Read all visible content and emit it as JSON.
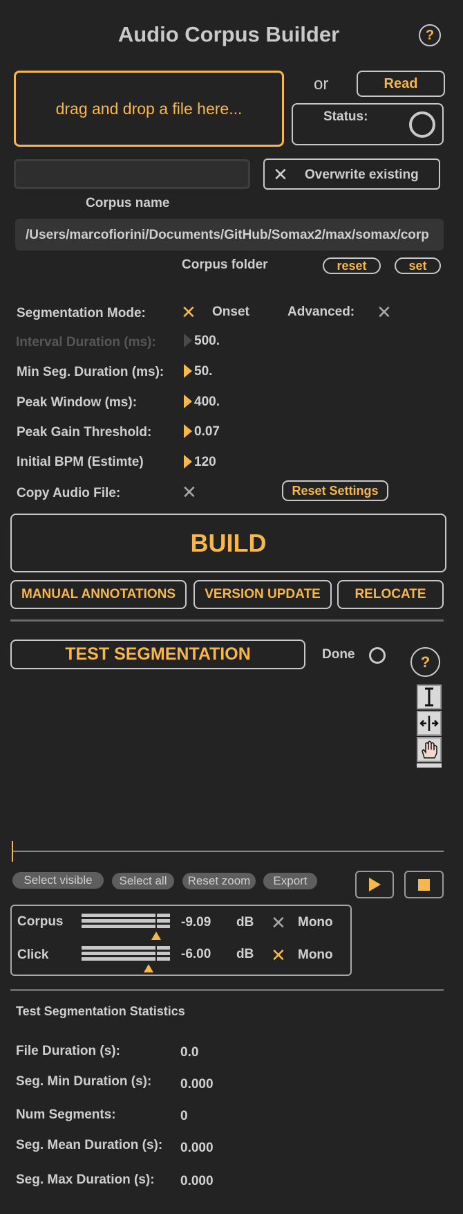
{
  "header": {
    "title": "Audio Corpus Builder",
    "help_label": "?"
  },
  "drop_zone": {
    "label": "drag and drop a file here..."
  },
  "or_label": "or",
  "read_button": "Read",
  "status": {
    "label": "Status:"
  },
  "overwrite": {
    "label": "Overwrite existing"
  },
  "corpus_name": {
    "label": "Corpus name",
    "value": ""
  },
  "corpus_folder": {
    "path": "/Users/marcofiorini/Documents/GitHub/Somax2/max/somax/corp",
    "label": "Corpus folder",
    "reset_label": "reset",
    "set_label": "set"
  },
  "segmentation": {
    "mode_label": "Segmentation Mode:",
    "mode_value": "Onset",
    "advanced_label": "Advanced:",
    "params": [
      {
        "label": "Interval Duration (ms):",
        "value": "500.",
        "disabled": true
      },
      {
        "label": "Min Seg. Duration (ms):",
        "value": "50."
      },
      {
        "label": "Peak Window (ms):",
        "value": "400."
      },
      {
        "label": "Peak Gain Threshold:",
        "value": "0.07"
      },
      {
        "label": "Initial BPM (Estimte)",
        "value": "120"
      }
    ],
    "copy_audio_label": "Copy Audio File:",
    "reset_settings_label": "Reset Settings"
  },
  "build_button": "BUILD",
  "actions": {
    "manual_annotations": "MANUAL ANNOTATIONS",
    "version_update": "VERSION UPDATE",
    "relocate": "RELOCATE"
  },
  "test": {
    "button": "TEST SEGMENTATION",
    "done_label": "Done",
    "help_label": "?"
  },
  "waveform_tools": [
    "select-tool",
    "move-tool",
    "hand-tool"
  ],
  "waveform_buttons": {
    "select_visible": "Select visible",
    "select_all": "Select all",
    "reset_zoom": "Reset zoom",
    "export": "Export"
  },
  "mixer": {
    "corpus": {
      "label": "Corpus",
      "value": "-9.09",
      "unit": "dB",
      "mono": "Mono",
      "level": 0.8
    },
    "click": {
      "label": "Click",
      "value": "-6.00",
      "unit": "dB",
      "mono": "Mono",
      "level": 0.72
    }
  },
  "stats": {
    "title": "Test Segmentation Statistics",
    "rows": [
      {
        "label": "File Duration (s):",
        "value": "0.0"
      },
      {
        "label": "Seg. Min Duration (s):",
        "value": "0.000"
      },
      {
        "label": "Num Segments:",
        "value": "0"
      },
      {
        "label": "Seg. Mean Duration (s):",
        "value": "0.000"
      },
      {
        "label": "Seg. Max Duration (s):",
        "value": "0.000"
      }
    ]
  },
  "colors": {
    "accent": "#f6b84d",
    "background": "#232323",
    "border": "#c9c9c9"
  }
}
